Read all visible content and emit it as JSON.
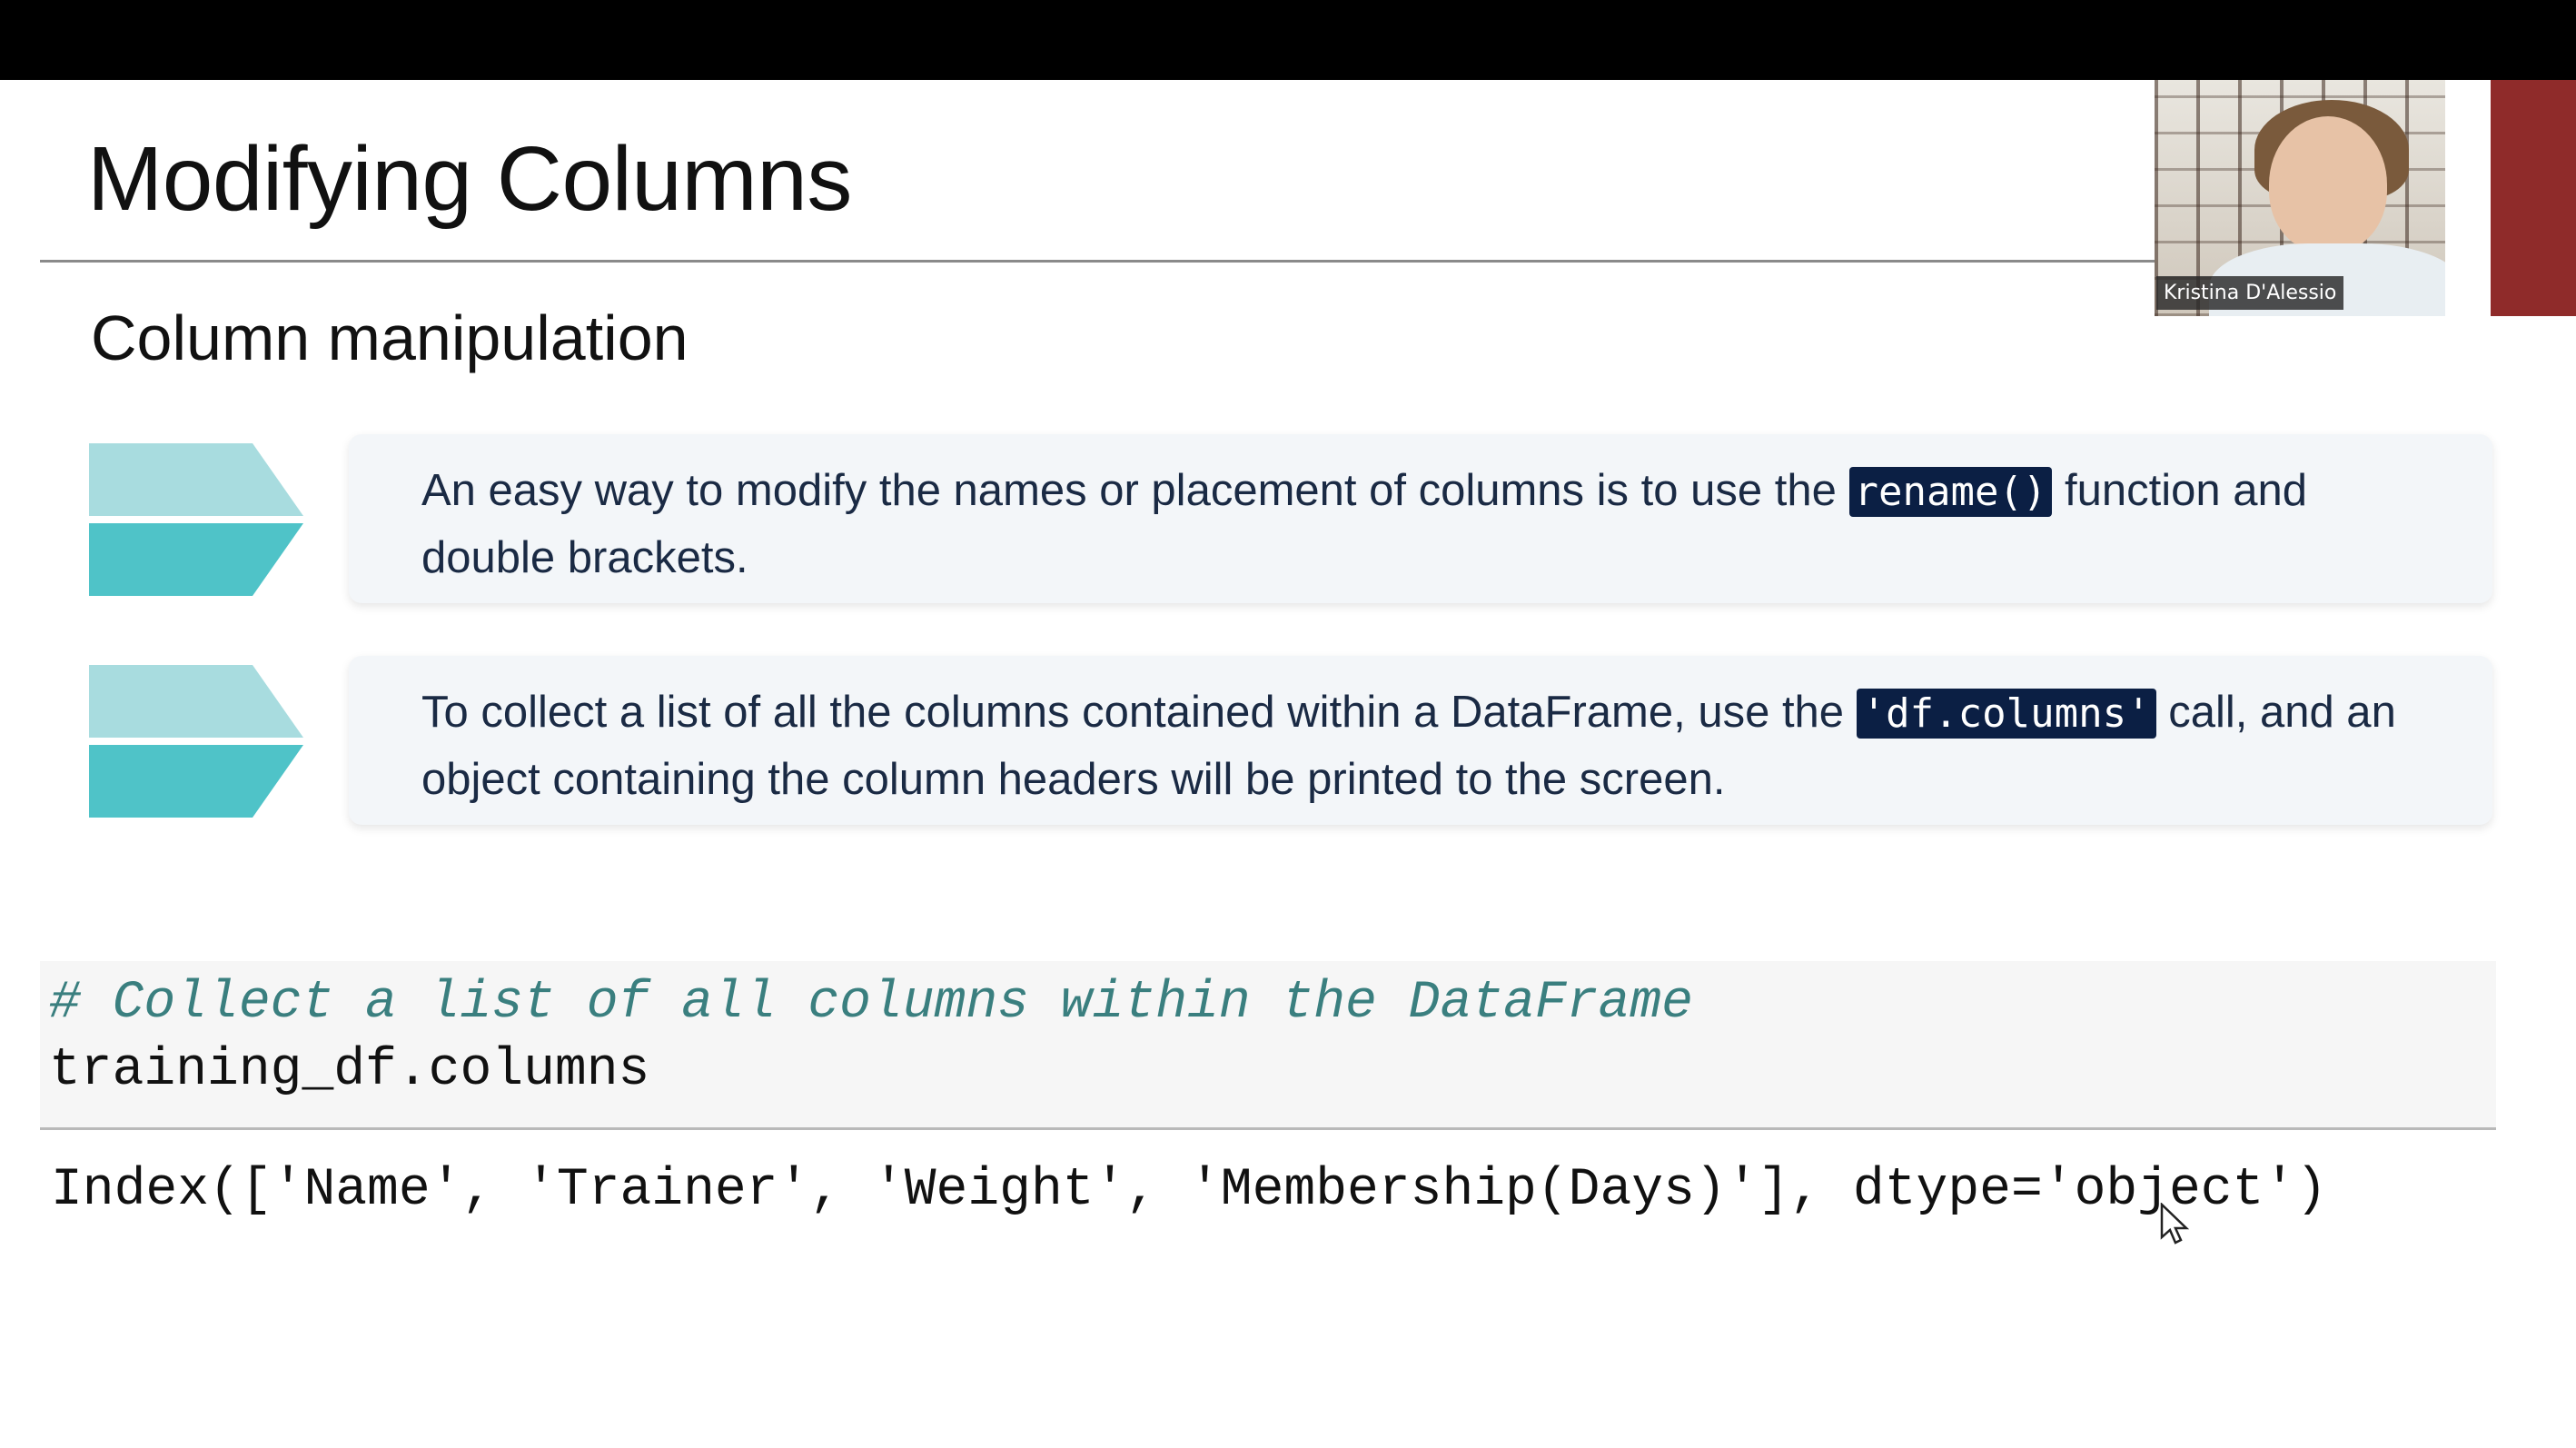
{
  "slide": {
    "title": "Modifying Columns",
    "subtitle": "Column manipulation",
    "bullets": [
      {
        "text_before": "An easy way to modify the names or placement of columns is to use the ",
        "code": "rename()",
        "text_after": " function and double brackets."
      },
      {
        "text_before": "To collect a list of all the columns contained within a DataFrame, use the ",
        "code": "'df.columns'",
        "text_after": " call, and an object containing the column headers will be printed to the screen."
      }
    ],
    "code_block": {
      "comment": "# Collect a list of all columns within the DataFrame",
      "statement": "training_df.columns"
    },
    "output": "Index(['Name', 'Trainer', 'Weight', 'Membership(Days)'], dtype='object')"
  },
  "video": {
    "participant_name": "Kristina D'Alessio"
  },
  "colors": {
    "chevron_light": "#a8dcdf",
    "chevron_dark": "#4fc3c8",
    "code_pill_bg": "#0b1f44",
    "comment_color": "#3a7f7f"
  },
  "icons": [
    "chevron-arrow-icon",
    "mouse-cursor-icon"
  ]
}
